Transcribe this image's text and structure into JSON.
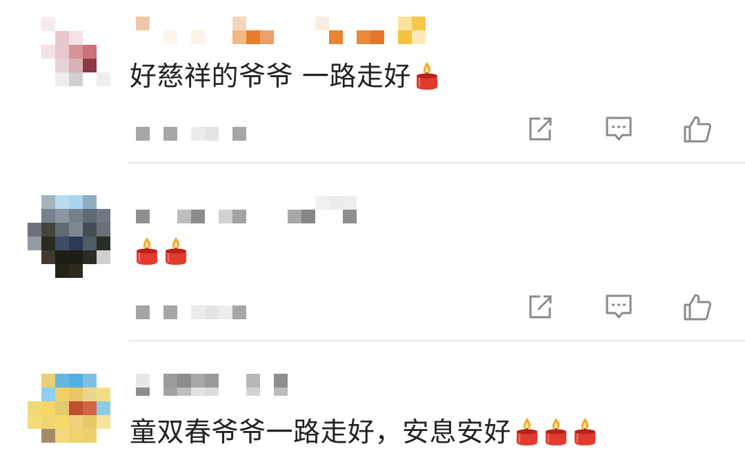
{
  "comments": [
    {
      "text": "好慈祥的爷爷 一路走好",
      "candles": 1
    },
    {
      "text": "",
      "candles": 2
    },
    {
      "text": "童双春爷爷一路走好，安息安好",
      "candles": 3
    }
  ],
  "icons": {
    "repost": "share-icon",
    "reply": "comment-icon",
    "like": "thumbs-up-icon",
    "emoji": "candle-icon"
  },
  "colors": {
    "text": "#222222",
    "icon": "#8a8a8a",
    "divider": "#e8e8e8",
    "candle": "#e23a2e"
  }
}
